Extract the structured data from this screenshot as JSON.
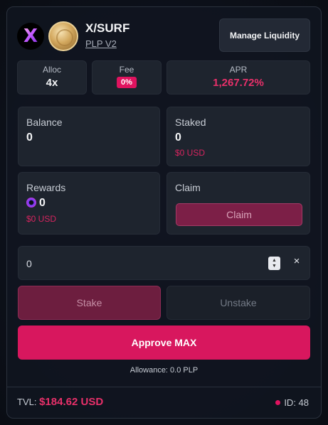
{
  "pair": {
    "title": "X/SURF",
    "subtitle": "PLP V2",
    "icons": [
      "x-token-icon",
      "surf-token-icon"
    ]
  },
  "manage_button": "Manage Liquidity",
  "stats": {
    "alloc_label": "Alloc",
    "alloc_value": "4x",
    "fee_label": "Fee",
    "fee_value": "0%",
    "apr_label": "APR",
    "apr_value": "1,267.72%"
  },
  "balance": {
    "label": "Balance",
    "value": "0"
  },
  "staked": {
    "label": "Staked",
    "value": "0",
    "usd": "$0 USD"
  },
  "rewards": {
    "label": "Rewards",
    "value": "0",
    "usd": "$0 USD",
    "icon": "reward-token-icon"
  },
  "claim": {
    "label": "Claim",
    "button": "Claim"
  },
  "amount_input": {
    "value": "0",
    "clear_symbol": "×"
  },
  "actions": {
    "stake": "Stake",
    "unstake": "Unstake",
    "approve": "Approve MAX",
    "allowance": "Allowance: 0.0 PLP"
  },
  "footer": {
    "tvl_label": "TVL:",
    "tvl_value": "$184.62 USD",
    "id": "ID: 48"
  },
  "colors": {
    "accent": "#d8175e",
    "apr": "#e8306a",
    "panel": "#1e242e",
    "background": "#0b0f17"
  }
}
